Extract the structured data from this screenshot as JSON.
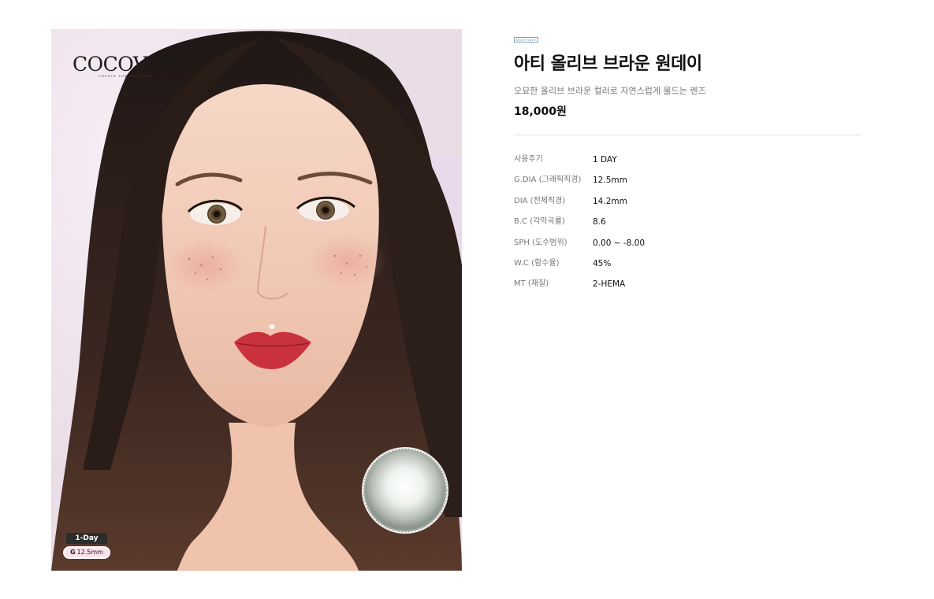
{
  "product_image": {
    "brand": "COCOVIEW",
    "tagline": "CREATE THE BEST EYE",
    "badge_period": "1-Day",
    "badge_gdia_prefix": "G",
    "badge_gdia_value": "12.5mm"
  },
  "product": {
    "category_tag": "MUST HAVE",
    "title": "아티 올리브 브라운 원데이",
    "description": "오묘한 올리브 브라운 컬러로 자연스럽게 물드는 렌즈",
    "price": "18,000원"
  },
  "specs": [
    {
      "label": "사용주기",
      "value": "1 DAY"
    },
    {
      "label": "G.DIA (그래픽직경)",
      "value": "12.5mm"
    },
    {
      "label": "DIA (전체직경)",
      "value": "14.2mm"
    },
    {
      "label": "B.C (각막곡률)",
      "value": "8.6"
    },
    {
      "label": "SPH (도수범위)",
      "value": "0.00 ~ -8.00"
    },
    {
      "label": "W.C (함수율)",
      "value": "45%"
    },
    {
      "label": "MT (재질)",
      "value": "2-HEMA"
    }
  ]
}
